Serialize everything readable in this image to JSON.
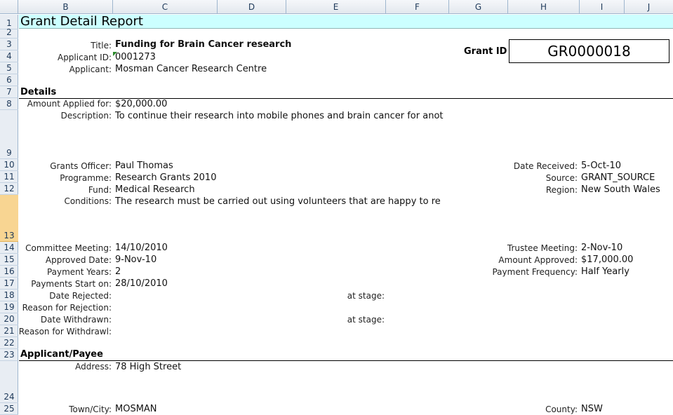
{
  "columns": [
    "B",
    "C",
    "D",
    "E",
    "F",
    "G",
    "H",
    "I",
    "J"
  ],
  "rows": [
    "1",
    "2",
    "3",
    "4",
    "5",
    "6",
    "7",
    "8",
    "9",
    "10",
    "11",
    "12",
    "13",
    "14",
    "15",
    "16",
    "17",
    "18",
    "19",
    "20",
    "21",
    "22",
    "23",
    "24",
    "25"
  ],
  "report": {
    "title": "Grant Detail Report",
    "grant_id_label": "Grant ID",
    "grant_id": "GR0000018"
  },
  "header_fields": {
    "title_label": "Title:",
    "title_value": "Funding for Brain Cancer research",
    "applicant_id_label": "Applicant ID:",
    "applicant_id_value": "0001273",
    "applicant_label": "Applicant:",
    "applicant_value": "Mosman Cancer Research Centre"
  },
  "details": {
    "heading": "Details",
    "amount_applied_label": "Amount Applied for:",
    "amount_applied_value": "$20,000.00",
    "description_label": "Description:",
    "description_value": "To continue their research into mobile phones and brain cancer for anot",
    "grants_officer_label": "Grants Officer:",
    "grants_officer_value": "Paul Thomas",
    "programme_label": "Programme:",
    "programme_value": "Research Grants 2010",
    "fund_label": "Fund:",
    "fund_value": "Medical Research",
    "conditions_label": "Conditions:",
    "conditions_value": "The research must be carried out using volunteers that are happy to re",
    "date_received_label": "Date Received:",
    "date_received_value": "5-Oct-10",
    "source_label": "Source:",
    "source_value": "GRANT_SOURCE",
    "region_label": "Region:",
    "region_value": "New South Wales",
    "committee_meeting_label": "Committee Meeting:",
    "committee_meeting_value": "14/10/2010",
    "approved_date_label": "Approved Date:",
    "approved_date_value": "9-Nov-10",
    "payment_years_label": "Payment Years:",
    "payment_years_value": "2",
    "payments_start_label": "Payments Start on:",
    "payments_start_value": "28/10/2010",
    "date_rejected_label": "Date Rejected:",
    "reason_rejection_label": "Reason for Rejection:",
    "date_withdrawn_label": "Date Withdrawn:",
    "reason_withdrawl_label": "Reason for Withdrawl:",
    "at_stage_label_1": "at stage:",
    "at_stage_label_2": "at stage:",
    "trustee_meeting_label": "Trustee Meeting:",
    "trustee_meeting_value": "2-Nov-10",
    "amount_approved_label": "Amount Approved:",
    "amount_approved_value": "$17,000.00",
    "payment_frequency_label": "Payment Frequency:",
    "payment_frequency_value": "Half Yearly"
  },
  "applicant_payee": {
    "heading": "Applicant/Payee",
    "address_label": "Address:",
    "address_value": "78 High Street",
    "town_label": "Town/City:",
    "town_value": "MOSMAN",
    "county_label": "County:",
    "county_value": "NSW"
  },
  "colors": {
    "title_band": "#ccffff",
    "header_bg": "#e3e8ee",
    "selected_row": "#f8d592",
    "comment_indicator": "#2a8a2a"
  }
}
